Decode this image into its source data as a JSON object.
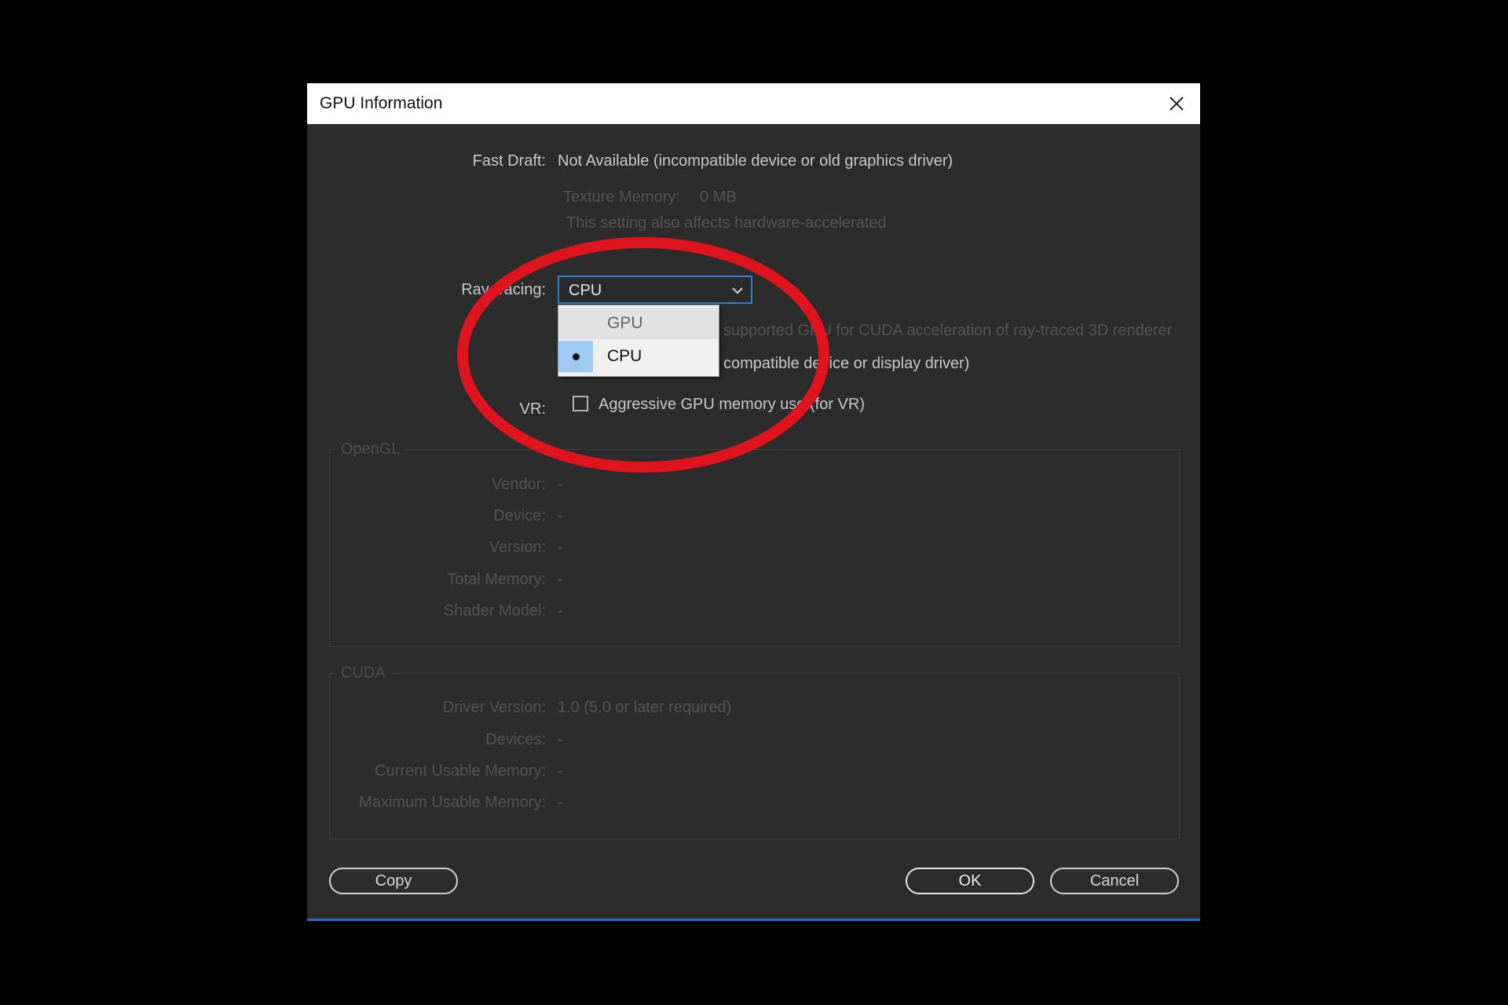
{
  "dialog": {
    "title": "GPU Information"
  },
  "fast_draft": {
    "label": "Fast Draft:",
    "value": "Not Available (incompatible device or old graphics driver)"
  },
  "texture_memory": {
    "label": "Texture Memory:",
    "value": "0 MB",
    "note": "This setting also affects hardware-accelerated"
  },
  "ray_tracing": {
    "label": "Ray-tracing:",
    "selected": "CPU",
    "options": [
      {
        "label": "GPU",
        "selected": false
      },
      {
        "label": "CPU",
        "selected": true
      }
    ],
    "hint_partial": "supported GPU for CUDA acceleration of ray-traced 3D renderer",
    "status_partial": "compatible device or display driver)"
  },
  "vr": {
    "label": "VR:",
    "checkbox_label": "Aggressive GPU memory use (for VR)",
    "checked": false
  },
  "opengl": {
    "group_title": "OpenGL",
    "rows": [
      {
        "label": "Vendor:",
        "value": "-"
      },
      {
        "label": "Device:",
        "value": "-"
      },
      {
        "label": "Version:",
        "value": "-"
      },
      {
        "label": "Total Memory:",
        "value": "-"
      },
      {
        "label": "Shader Model:",
        "value": "-"
      }
    ]
  },
  "cuda": {
    "group_title": "CUDA",
    "rows": [
      {
        "label": "Driver Version:",
        "value": "1.0 (5.0 or later required)"
      },
      {
        "label": "Devices:",
        "value": "-"
      },
      {
        "label": "Current Usable Memory:",
        "value": "-"
      },
      {
        "label": "Maximum Usable Memory:",
        "value": "-"
      }
    ]
  },
  "buttons": {
    "copy": "Copy",
    "ok": "OK",
    "cancel": "Cancel"
  },
  "colors": {
    "annotation_circle": "#e0141e",
    "focus_border": "#2d7fd6",
    "dialog_bg": "#2c2c2c"
  }
}
